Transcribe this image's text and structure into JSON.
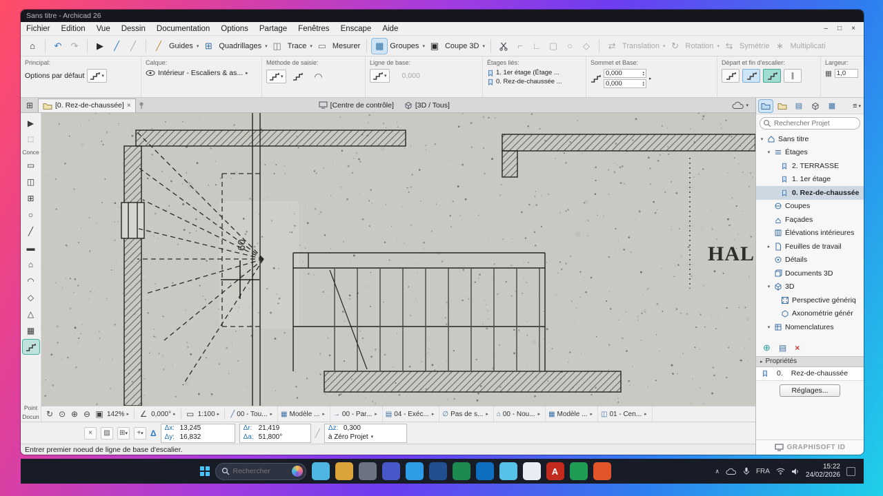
{
  "window": {
    "title": "Sans titre - Archicad 26",
    "minimize": "–",
    "maximize": "□",
    "close": "×"
  },
  "menubar": {
    "items": [
      "Fichier",
      "Edition",
      "Vue",
      "Dessin",
      "Documentation",
      "Options",
      "Partage",
      "Fenêtres",
      "Enscape",
      "Aide"
    ]
  },
  "toolbar": {
    "guides": "Guides",
    "quadrillages": "Quadrillages",
    "trace": "Trace",
    "mesurer": "Mesurer",
    "groupes": "Groupes",
    "coupe3d": "Coupe 3D",
    "translation": "Translation",
    "rotation": "Rotation",
    "symetrie": "Symétrie",
    "multiplication": "Multiplicati"
  },
  "infobar": {
    "principal": {
      "label": "Principal:",
      "value": "Options par défaut"
    },
    "calque": {
      "label": "Calque:",
      "value": "Intérieur - Escaliers & as..."
    },
    "methode": {
      "label": "Méthode de saisie:"
    },
    "ligne_base": {
      "label": "Ligne de base:",
      "value": "0,000"
    },
    "etages_lies": {
      "label": "Étages liés:",
      "rows": [
        "1. 1er étage (Étage ...",
        "0. Rez-de-chaussée ..."
      ]
    },
    "sommet_base": {
      "label": "Sommet et Base:",
      "sommet": "0,000",
      "base": "0,000"
    },
    "depart_fin": {
      "label": "Départ et fin d'escalier:"
    },
    "largeur": {
      "label": "Largeur:",
      "value": "1,0"
    }
  },
  "tabbar": {
    "plan": "[0. Rez-de-chaussée]",
    "controle": "[Centre de contrôle]",
    "trois_d": "[3D / Tous]"
  },
  "toolbox": {
    "group_conception": "Conce",
    "group_point": "Point",
    "group_document": "Docun"
  },
  "canvas": {
    "hall": "HAL",
    "dim": "60"
  },
  "navigator": {
    "search_placeholder": "Rechercher Projet",
    "tree": [
      {
        "label": "Sans titre",
        "level": 0,
        "chevron": "v",
        "icon": "project"
      },
      {
        "label": "Étages",
        "level": 1,
        "chevron": "v",
        "icon": "stories"
      },
      {
        "label": "2. TERRASSE",
        "level": 2,
        "icon": "story"
      },
      {
        "label": "1. 1er étage",
        "level": 2,
        "icon": "story"
      },
      {
        "label": "0. Rez-de-chaussée",
        "level": 2,
        "icon": "story",
        "selected": true
      },
      {
        "label": "Coupes",
        "level": 1,
        "icon": "sections"
      },
      {
        "label": "Façades",
        "level": 1,
        "icon": "elevations"
      },
      {
        "label": "Élévations intérieures",
        "level": 1,
        "icon": "interior"
      },
      {
        "label": "Feuilles de travail",
        "level": 1,
        "chevron": ">",
        "icon": "worksheets"
      },
      {
        "label": "Détails",
        "level": 1,
        "icon": "details"
      },
      {
        "label": "Documents 3D",
        "level": 1,
        "icon": "doc3d"
      },
      {
        "label": "3D",
        "level": 1,
        "chevron": "v",
        "icon": "cube"
      },
      {
        "label": "Perspective génériq",
        "level": 2,
        "icon": "persp"
      },
      {
        "label": "Axonométrie génér",
        "level": 2,
        "icon": "axo"
      },
      {
        "label": "Nomenclatures",
        "level": 1,
        "chevron": "v",
        "icon": "schedules"
      }
    ],
    "properties": "Propriétés",
    "story_num": "0.",
    "story_name": "Rez-de-chaussée",
    "settings": "Réglages..."
  },
  "quickbar": {
    "zoom": "142%",
    "rotation": "0,000°",
    "scale": "1:100",
    "chips": [
      {
        "label": "00 - Tou...",
        "icon": "pen"
      },
      {
        "label": "Modèle ...",
        "icon": "layers"
      },
      {
        "label": "00 - Par...",
        "icon": "arrow"
      },
      {
        "label": "04 - Exéc...",
        "icon": "layout"
      },
      {
        "label": "Pas de s...",
        "icon": "none"
      },
      {
        "label": "00 - Nou...",
        "icon": "reno"
      },
      {
        "label": "Modèle ...",
        "icon": "model"
      },
      {
        "label": "01 - Cen...",
        "icon": "screen"
      }
    ]
  },
  "tracker": {
    "dx": "Δx:",
    "dx_v": "13,245",
    "dy": "Δy:",
    "dy_v": "16,832",
    "dr": "Δr:",
    "dr_v": "21,419",
    "da": "Δa:",
    "da_v": "51,800°",
    "dz": "Δz:",
    "dz_v": "0,300",
    "origin": "à Zéro Projet"
  },
  "status_message": "Entrer premier noeud de ligne de base d'escalier.",
  "branding": "GRAPHISOFT ID",
  "taskbar": {
    "search": "Rechercher",
    "lang": "FRA",
    "time": "15:22",
    "date": "24/02/2026",
    "apps": [
      {
        "name": "taskbar-app-1",
        "color": "#4db6e2"
      },
      {
        "name": "taskbar-app-2",
        "color": "#d9a33a"
      },
      {
        "name": "taskbar-app-3",
        "color": "#6b7280"
      },
      {
        "name": "taskbar-app-4",
        "color": "#4759c9"
      },
      {
        "name": "taskbar-app-5",
        "color": "#2e9be6"
      },
      {
        "name": "taskbar-app-6",
        "color": "#224f8f"
      },
      {
        "name": "taskbar-app-7",
        "color": "#1d8a50"
      },
      {
        "name": "taskbar-app-8",
        "color": "#0e6fc0"
      },
      {
        "name": "taskbar-app-9",
        "color": "#56c1e8"
      },
      {
        "name": "taskbar-app-10",
        "color": "#e8edf4"
      },
      {
        "name": "taskbar-app-11",
        "color": "#c42b1f",
        "glyph": "A"
      },
      {
        "name": "taskbar-app-12",
        "color": "#1f9d55"
      },
      {
        "name": "taskbar-app-13",
        "color": "#e2552a"
      }
    ]
  }
}
